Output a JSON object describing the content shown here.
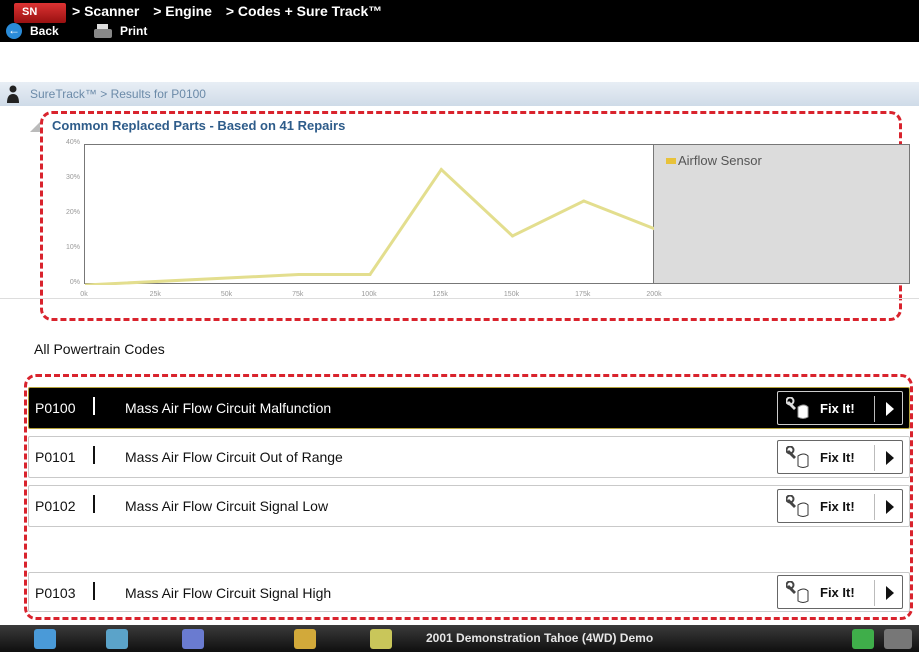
{
  "titlebar": {
    "logo_text": "SN",
    "crumbs": [
      "> Scanner",
      "> Engine",
      "> Codes + Sure Track™"
    ],
    "back_label": "Back",
    "print_label": "Print"
  },
  "subcrumb": {
    "text": "SureTrack™ > Results for P0100"
  },
  "chart": {
    "title": "Common Replaced Parts - Based on 41 Repairs",
    "legend": "Airflow Sensor",
    "series_color": "#e3de8e"
  },
  "chart_data": {
    "type": "line",
    "title": "Common Replaced Parts - Based on 41 Repairs",
    "xlabel": "",
    "ylabel": "",
    "y_tick_labels": [
      "0%",
      "10%",
      "20%",
      "30%",
      "40%"
    ],
    "x_tick_labels": [
      "0k",
      "25k",
      "50k",
      "75k",
      "100k",
      "125k",
      "150k",
      "175k",
      "200k"
    ],
    "ylim": [
      0,
      40
    ],
    "xlim": [
      0,
      200
    ],
    "grid": false,
    "legend_position": "right",
    "series": [
      {
        "name": "Airflow Sensor",
        "x": [
          0,
          75,
          100,
          125,
          150,
          175,
          200
        ],
        "y": [
          0,
          3,
          3,
          33,
          14,
          24,
          16
        ]
      }
    ]
  },
  "codes": {
    "heading": "All Powertrain Codes",
    "fix_label": "Fix It!",
    "rows": [
      {
        "code": "P0100",
        "desc": "Mass Air Flow Circuit Malfunction"
      },
      {
        "code": "P0101",
        "desc": "Mass Air Flow Circuit Out of Range"
      },
      {
        "code": "P0102",
        "desc": "Mass Air Flow Circuit Signal Low"
      },
      {
        "code": "P0103",
        "desc": "Mass Air Flow Circuit Signal High"
      }
    ]
  },
  "taskbar": {
    "vehicle": "2001 Demonstration Tahoe (4WD) Demo"
  },
  "colors": {
    "accent_dash": "#d9232d",
    "titlebar": "#000000",
    "selected_row": "#000000"
  }
}
